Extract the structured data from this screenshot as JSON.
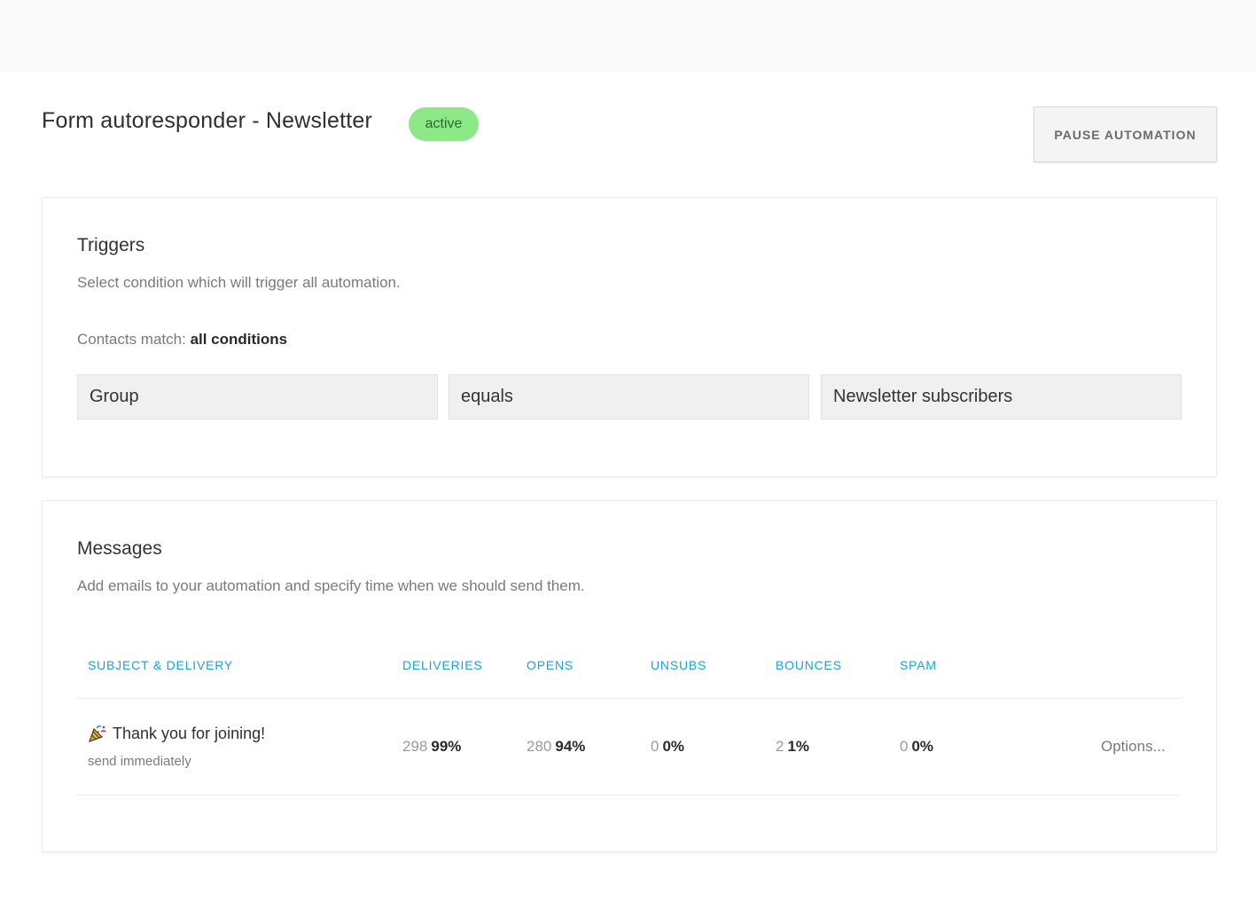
{
  "header": {
    "title": "Form autoresponder - Newsletter",
    "status": "active",
    "pause_label": "PAUSE AUTOMATION",
    "colors": {
      "badge_bg": "#8de887",
      "accent": "#1aa3d9"
    }
  },
  "triggers": {
    "title": "Triggers",
    "description": "Select condition which will trigger all automation.",
    "match_prefix": "Contacts match:",
    "match_value": "all conditions",
    "condition": {
      "field": "Group",
      "operator": "equals",
      "value": "Newsletter subscribers"
    }
  },
  "messages": {
    "title": "Messages",
    "description": "Add emails to your automation and specify time when we should send them.",
    "columns": [
      "SUBJECT & DELIVERY",
      "DELIVERIES",
      "OPENS",
      "UNSUBS",
      "BOUNCES",
      "SPAM"
    ],
    "rows": [
      {
        "icon": "party-popper-icon",
        "subject": "Thank you for joining!",
        "delivery": "send immediately",
        "deliveries": {
          "count": "298",
          "pct": "99%"
        },
        "opens": {
          "count": "280",
          "pct": "94%"
        },
        "unsubs": {
          "count": "0",
          "pct": "0%"
        },
        "bounces": {
          "count": "2",
          "pct": "1%"
        },
        "spam": {
          "count": "0",
          "pct": "0%"
        },
        "options_label": "Options..."
      }
    ]
  }
}
